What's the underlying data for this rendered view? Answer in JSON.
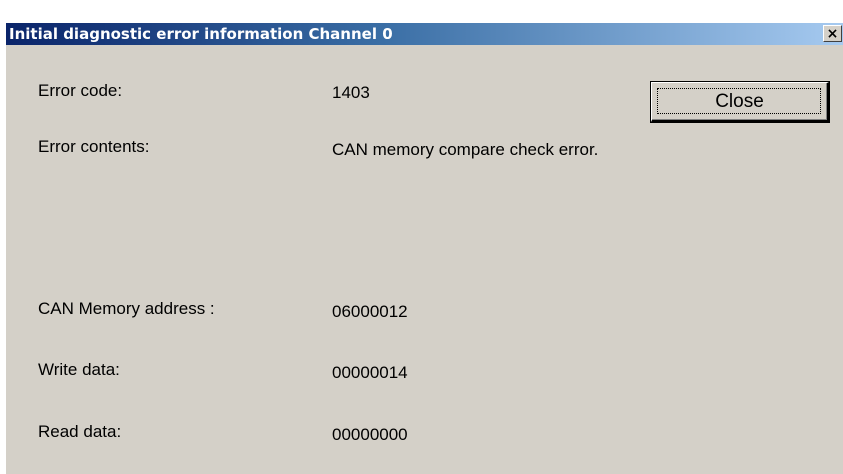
{
  "window": {
    "title": "Initial diagnostic error information Channel 0",
    "close_glyph": "×"
  },
  "fields": {
    "error_code_label": "Error code:",
    "error_code_value": "1403",
    "error_contents_label": "Error contents:",
    "error_contents_value": "CAN memory compare check error.",
    "can_memory_address_label": "CAN Memory address :",
    "can_memory_address_value": "06000012",
    "write_data_label": "Write data:",
    "write_data_value": "00000014",
    "read_data_label": "Read data:",
    "read_data_value": "00000000"
  },
  "buttons": {
    "close_label": "Close"
  },
  "colors": {
    "dialog_background": "#d4d0c8",
    "titlebar_start": "#0a246a",
    "titlebar_end": "#a6caf0",
    "title_text": "#ffffff"
  }
}
